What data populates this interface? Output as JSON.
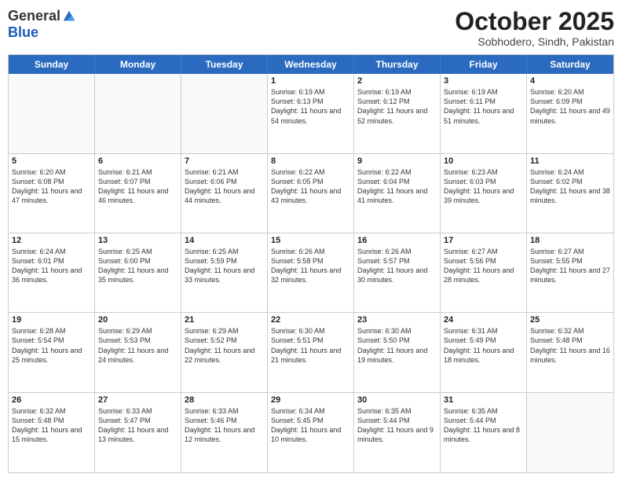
{
  "header": {
    "logo_general": "General",
    "logo_blue": "Blue",
    "month_title": "October 2025",
    "location": "Sobhodero, Sindh, Pakistan"
  },
  "weekdays": [
    "Sunday",
    "Monday",
    "Tuesday",
    "Wednesday",
    "Thursday",
    "Friday",
    "Saturday"
  ],
  "weeks": [
    [
      {
        "day": "",
        "sunrise": "",
        "sunset": "",
        "daylight": ""
      },
      {
        "day": "",
        "sunrise": "",
        "sunset": "",
        "daylight": ""
      },
      {
        "day": "",
        "sunrise": "",
        "sunset": "",
        "daylight": ""
      },
      {
        "day": "1",
        "sunrise": "Sunrise: 6:19 AM",
        "sunset": "Sunset: 6:13 PM",
        "daylight": "Daylight: 11 hours and 54 minutes."
      },
      {
        "day": "2",
        "sunrise": "Sunrise: 6:19 AM",
        "sunset": "Sunset: 6:12 PM",
        "daylight": "Daylight: 11 hours and 52 minutes."
      },
      {
        "day": "3",
        "sunrise": "Sunrise: 6:19 AM",
        "sunset": "Sunset: 6:11 PM",
        "daylight": "Daylight: 11 hours and 51 minutes."
      },
      {
        "day": "4",
        "sunrise": "Sunrise: 6:20 AM",
        "sunset": "Sunset: 6:09 PM",
        "daylight": "Daylight: 11 hours and 49 minutes."
      }
    ],
    [
      {
        "day": "5",
        "sunrise": "Sunrise: 6:20 AM",
        "sunset": "Sunset: 6:08 PM",
        "daylight": "Daylight: 11 hours and 47 minutes."
      },
      {
        "day": "6",
        "sunrise": "Sunrise: 6:21 AM",
        "sunset": "Sunset: 6:07 PM",
        "daylight": "Daylight: 11 hours and 46 minutes."
      },
      {
        "day": "7",
        "sunrise": "Sunrise: 6:21 AM",
        "sunset": "Sunset: 6:06 PM",
        "daylight": "Daylight: 11 hours and 44 minutes."
      },
      {
        "day": "8",
        "sunrise": "Sunrise: 6:22 AM",
        "sunset": "Sunset: 6:05 PM",
        "daylight": "Daylight: 11 hours and 43 minutes."
      },
      {
        "day": "9",
        "sunrise": "Sunrise: 6:22 AM",
        "sunset": "Sunset: 6:04 PM",
        "daylight": "Daylight: 11 hours and 41 minutes."
      },
      {
        "day": "10",
        "sunrise": "Sunrise: 6:23 AM",
        "sunset": "Sunset: 6:03 PM",
        "daylight": "Daylight: 11 hours and 39 minutes."
      },
      {
        "day": "11",
        "sunrise": "Sunrise: 6:24 AM",
        "sunset": "Sunset: 6:02 PM",
        "daylight": "Daylight: 11 hours and 38 minutes."
      }
    ],
    [
      {
        "day": "12",
        "sunrise": "Sunrise: 6:24 AM",
        "sunset": "Sunset: 6:01 PM",
        "daylight": "Daylight: 11 hours and 36 minutes."
      },
      {
        "day": "13",
        "sunrise": "Sunrise: 6:25 AM",
        "sunset": "Sunset: 6:00 PM",
        "daylight": "Daylight: 11 hours and 35 minutes."
      },
      {
        "day": "14",
        "sunrise": "Sunrise: 6:25 AM",
        "sunset": "Sunset: 5:59 PM",
        "daylight": "Daylight: 11 hours and 33 minutes."
      },
      {
        "day": "15",
        "sunrise": "Sunrise: 6:26 AM",
        "sunset": "Sunset: 5:58 PM",
        "daylight": "Daylight: 11 hours and 32 minutes."
      },
      {
        "day": "16",
        "sunrise": "Sunrise: 6:26 AM",
        "sunset": "Sunset: 5:57 PM",
        "daylight": "Daylight: 11 hours and 30 minutes."
      },
      {
        "day": "17",
        "sunrise": "Sunrise: 6:27 AM",
        "sunset": "Sunset: 5:56 PM",
        "daylight": "Daylight: 11 hours and 28 minutes."
      },
      {
        "day": "18",
        "sunrise": "Sunrise: 6:27 AM",
        "sunset": "Sunset: 5:55 PM",
        "daylight": "Daylight: 11 hours and 27 minutes."
      }
    ],
    [
      {
        "day": "19",
        "sunrise": "Sunrise: 6:28 AM",
        "sunset": "Sunset: 5:54 PM",
        "daylight": "Daylight: 11 hours and 25 minutes."
      },
      {
        "day": "20",
        "sunrise": "Sunrise: 6:29 AM",
        "sunset": "Sunset: 5:53 PM",
        "daylight": "Daylight: 11 hours and 24 minutes."
      },
      {
        "day": "21",
        "sunrise": "Sunrise: 6:29 AM",
        "sunset": "Sunset: 5:52 PM",
        "daylight": "Daylight: 11 hours and 22 minutes."
      },
      {
        "day": "22",
        "sunrise": "Sunrise: 6:30 AM",
        "sunset": "Sunset: 5:51 PM",
        "daylight": "Daylight: 11 hours and 21 minutes."
      },
      {
        "day": "23",
        "sunrise": "Sunrise: 6:30 AM",
        "sunset": "Sunset: 5:50 PM",
        "daylight": "Daylight: 11 hours and 19 minutes."
      },
      {
        "day": "24",
        "sunrise": "Sunrise: 6:31 AM",
        "sunset": "Sunset: 5:49 PM",
        "daylight": "Daylight: 11 hours and 18 minutes."
      },
      {
        "day": "25",
        "sunrise": "Sunrise: 6:32 AM",
        "sunset": "Sunset: 5:48 PM",
        "daylight": "Daylight: 11 hours and 16 minutes."
      }
    ],
    [
      {
        "day": "26",
        "sunrise": "Sunrise: 6:32 AM",
        "sunset": "Sunset: 5:48 PM",
        "daylight": "Daylight: 11 hours and 15 minutes."
      },
      {
        "day": "27",
        "sunrise": "Sunrise: 6:33 AM",
        "sunset": "Sunset: 5:47 PM",
        "daylight": "Daylight: 11 hours and 13 minutes."
      },
      {
        "day": "28",
        "sunrise": "Sunrise: 6:33 AM",
        "sunset": "Sunset: 5:46 PM",
        "daylight": "Daylight: 11 hours and 12 minutes."
      },
      {
        "day": "29",
        "sunrise": "Sunrise: 6:34 AM",
        "sunset": "Sunset: 5:45 PM",
        "daylight": "Daylight: 11 hours and 10 minutes."
      },
      {
        "day": "30",
        "sunrise": "Sunrise: 6:35 AM",
        "sunset": "Sunset: 5:44 PM",
        "daylight": "Daylight: 11 hours and 9 minutes."
      },
      {
        "day": "31",
        "sunrise": "Sunrise: 6:35 AM",
        "sunset": "Sunset: 5:44 PM",
        "daylight": "Daylight: 11 hours and 8 minutes."
      },
      {
        "day": "",
        "sunrise": "",
        "sunset": "",
        "daylight": ""
      }
    ]
  ]
}
